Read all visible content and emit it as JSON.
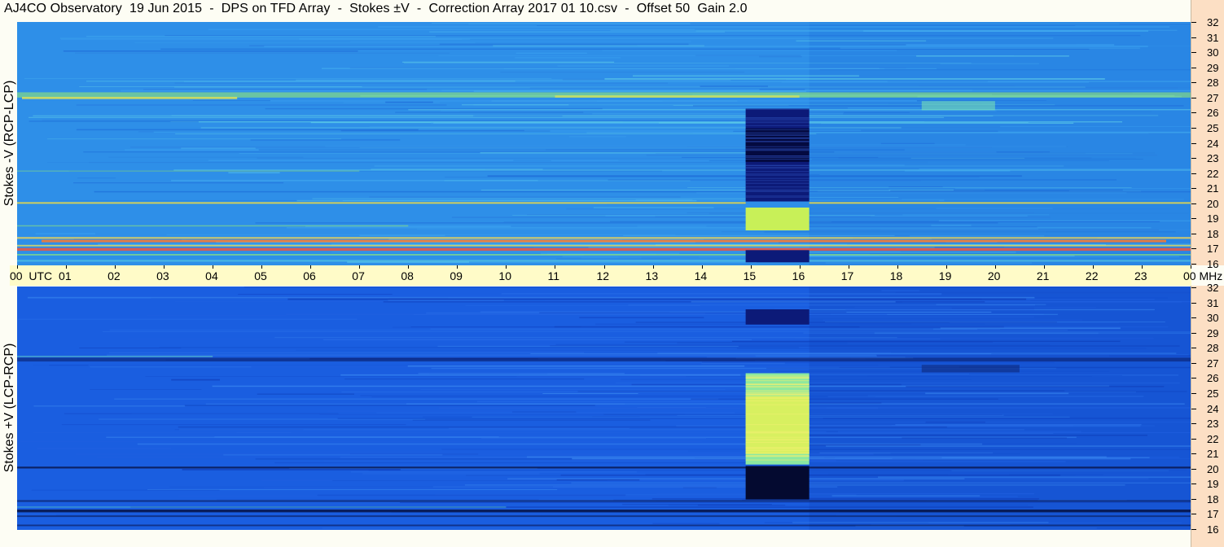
{
  "title": "AJ4CO Observatory  19 Jun 2015  -  DPS on TFD Array  -  Stokes ±V  -  Correction Array 2017 01 10.csv  -  Offset 50  Gain 2.0",
  "chart_data": [
    {
      "type": "heatmap",
      "name": "top",
      "ylabel": "Stokes -V (RCP-LCP)",
      "y_ticks": [
        "32",
        "31",
        "30",
        "29",
        "28",
        "27",
        "26",
        "25",
        "24",
        "23",
        "22",
        "21",
        "20",
        "19",
        "18",
        "17",
        "16"
      ],
      "ylim": [
        16,
        32
      ],
      "y_unit": "MHz",
      "xlim": [
        0,
        24
      ],
      "bands": [
        {
          "f": 27.2,
          "h": 0.35,
          "c": "#9cf06a",
          "x0": 0,
          "x1": 24,
          "o": 0.55
        },
        {
          "f": 27.0,
          "h": 0.15,
          "c": "#f0e848",
          "x0": 0.1,
          "x1": 4.5,
          "o": 0.75
        },
        {
          "f": 27.1,
          "h": 0.15,
          "c": "#f0e848",
          "x0": 11,
          "x1": 16,
          "o": 0.6
        },
        {
          "f": 26.5,
          "h": 0.6,
          "c": "#7ee8b0",
          "x0": 18.5,
          "x1": 20.0,
          "o": 0.55
        },
        {
          "f": 20.1,
          "h": 0.1,
          "c": "#e8d848",
          "x0": 0,
          "x1": 24,
          "o": 0.9
        },
        {
          "f": 17.8,
          "h": 0.12,
          "c": "#ffd84a",
          "x0": 0,
          "x1": 24,
          "o": 0.75
        },
        {
          "f": 17.6,
          "h": 0.16,
          "c": "#ff7a2a",
          "x0": 0.5,
          "x1": 23.5,
          "o": 0.85
        },
        {
          "f": 17.3,
          "h": 0.1,
          "c": "#ffe84a",
          "x0": 0,
          "x1": 24,
          "o": 0.7
        },
        {
          "f": 17.05,
          "h": 0.18,
          "c": "#ff5030",
          "x0": 0,
          "x1": 24,
          "o": 0.8
        },
        {
          "f": 16.7,
          "h": 0.1,
          "c": "#9cf06a",
          "x0": 0,
          "x1": 24,
          "o": 0.6
        },
        {
          "f": 16.3,
          "h": 0.12,
          "c": "#5ad0e0",
          "x0": 0,
          "x1": 24,
          "o": 0.6
        },
        {
          "f": 18.6,
          "h": 0.08,
          "c": "#9cf06a",
          "x0": 0,
          "x1": 8,
          "o": 0.5
        },
        {
          "f": 22.2,
          "h": 0.08,
          "c": "#9cf06a",
          "x0": 0,
          "x1": 7,
          "o": 0.35
        }
      ],
      "blocks": [
        {
          "f0": 20.2,
          "f1": 26.3,
          "x0": 14.9,
          "x1": 16.2,
          "c": "#0c1a78"
        },
        {
          "f0": 22.8,
          "f1": 25.0,
          "x0": 14.9,
          "x1": 16.2,
          "c": "#040a40"
        },
        {
          "f0": 18.3,
          "f1": 19.8,
          "x0": 14.9,
          "x1": 16.2,
          "c": "#c8f058"
        },
        {
          "f0": 16.2,
          "f1": 17.0,
          "x0": 14.9,
          "x1": 16.2,
          "c": "#0c1a78"
        },
        {
          "f0": 19.8,
          "f1": 20.2,
          "x0": 14.9,
          "x1": 16.2,
          "c": "#2e8fe8"
        }
      ]
    },
    {
      "type": "heatmap",
      "name": "bottom",
      "ylabel": "Stokes +V (LCP-RCP)",
      "y_ticks": [
        "32",
        "31",
        "30",
        "29",
        "28",
        "27",
        "26",
        "25",
        "24",
        "23",
        "22",
        "21",
        "20",
        "19",
        "18",
        "17",
        "16"
      ],
      "ylim": [
        16,
        32
      ],
      "y_unit": "MHz",
      "xlim": [
        0,
        24
      ],
      "bands": [
        {
          "f": 27.2,
          "h": 0.25,
          "c": "#0a1a60",
          "x0": 0,
          "x1": 24,
          "o": 0.55
        },
        {
          "f": 27.4,
          "h": 0.1,
          "c": "#6ae0c0",
          "x0": 0,
          "x1": 4,
          "o": 0.45
        },
        {
          "f": 26.6,
          "h": 0.5,
          "c": "#0a1a60",
          "x0": 18.5,
          "x1": 20.5,
          "o": 0.45
        },
        {
          "f": 20.1,
          "h": 0.12,
          "c": "#0a1850",
          "x0": 0,
          "x1": 24,
          "o": 0.85
        },
        {
          "f": 17.9,
          "h": 0.12,
          "c": "#0a1850",
          "x0": 0,
          "x1": 24,
          "o": 0.6
        },
        {
          "f": 17.25,
          "h": 0.18,
          "c": "#040a30",
          "x0": 0,
          "x1": 24,
          "o": 0.75
        },
        {
          "f": 16.9,
          "h": 0.1,
          "c": "#0a1850",
          "x0": 0,
          "x1": 24,
          "o": 0.6
        },
        {
          "f": 17.5,
          "h": 0.08,
          "c": "#6ae0c0",
          "x0": 0,
          "x1": 10,
          "o": 0.4
        },
        {
          "f": 16.3,
          "h": 0.1,
          "c": "#0a1850",
          "x0": 0,
          "x1": 24,
          "o": 0.6
        }
      ],
      "blocks": [
        {
          "f0": 20.3,
          "f1": 26.3,
          "x0": 14.9,
          "x1": 16.2,
          "c": "#8ce8a0"
        },
        {
          "f0": 21.0,
          "f1": 24.8,
          "x0": 14.9,
          "x1": 16.2,
          "c": "#d8f060"
        },
        {
          "f0": 18.0,
          "f1": 20.2,
          "x0": 14.9,
          "x1": 16.2,
          "c": "#040a30"
        },
        {
          "f0": 29.5,
          "f1": 30.5,
          "x0": 14.9,
          "x1": 16.2,
          "c": "#0c1a78"
        }
      ]
    }
  ],
  "time_axis": {
    "labels": [
      "00  UTC",
      "01",
      "02",
      "03",
      "04",
      "05",
      "06",
      "07",
      "08",
      "09",
      "10",
      "11",
      "12",
      "13",
      "14",
      "15",
      "16",
      "17",
      "18",
      "19",
      "20",
      "21",
      "22",
      "23",
      "00 MHz"
    ],
    "range": [
      0,
      24
    ]
  }
}
